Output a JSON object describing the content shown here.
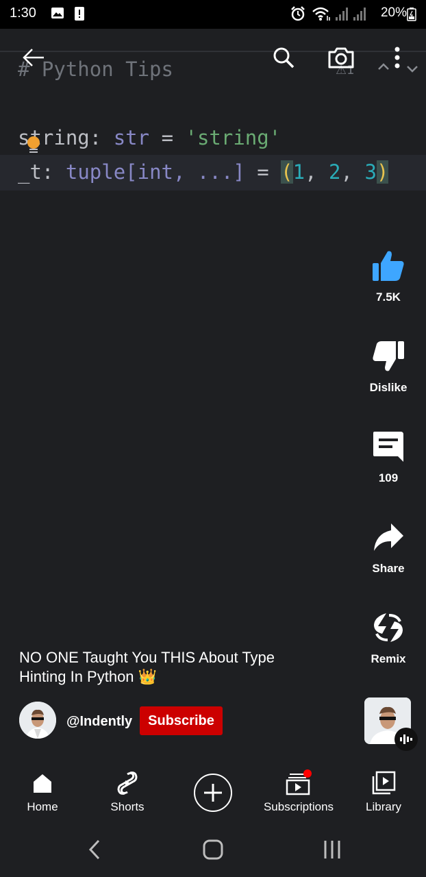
{
  "status_bar": {
    "time": "1:30",
    "battery": "20%",
    "icons": [
      "image-icon",
      "alert-icon",
      "alarm-icon",
      "wifi-icon",
      "signal-icon",
      "signal-icon",
      "battery-icon"
    ]
  },
  "video": {
    "code_comment": "# Python Tips",
    "line1": {
      "var": "string",
      "colon": ":",
      "type": "str",
      "eq": "=",
      "value": "'string'"
    },
    "line2": {
      "var": "_t",
      "colon": ":",
      "type": "tuple[int, ...]",
      "eq": "=",
      "open": "(",
      "n1": "1",
      "c1": ",",
      "n2": "2",
      "c2": ",",
      "n3": "3",
      "close": ")"
    },
    "warning_count": "1"
  },
  "actions": {
    "like_count": "7.5K",
    "dislike_label": "Dislike",
    "comment_count": "109",
    "share_label": "Share",
    "remix_label": "Remix"
  },
  "short": {
    "title": "NO ONE Taught You THIS About Type Hinting In Python 👑",
    "channel": "@Indently",
    "subscribe_label": "Subscribe"
  },
  "bottom_nav": {
    "items": [
      {
        "label": "Home",
        "icon": "home-icon"
      },
      {
        "label": "Shorts",
        "icon": "shorts-icon"
      },
      {
        "label": "Subscriptions",
        "icon": "subscriptions-icon"
      },
      {
        "label": "Library",
        "icon": "library-icon"
      }
    ]
  },
  "colors": {
    "subscribe": "#cc0000",
    "like_blue": "#3ea6ff",
    "notif": "#ff0000"
  }
}
